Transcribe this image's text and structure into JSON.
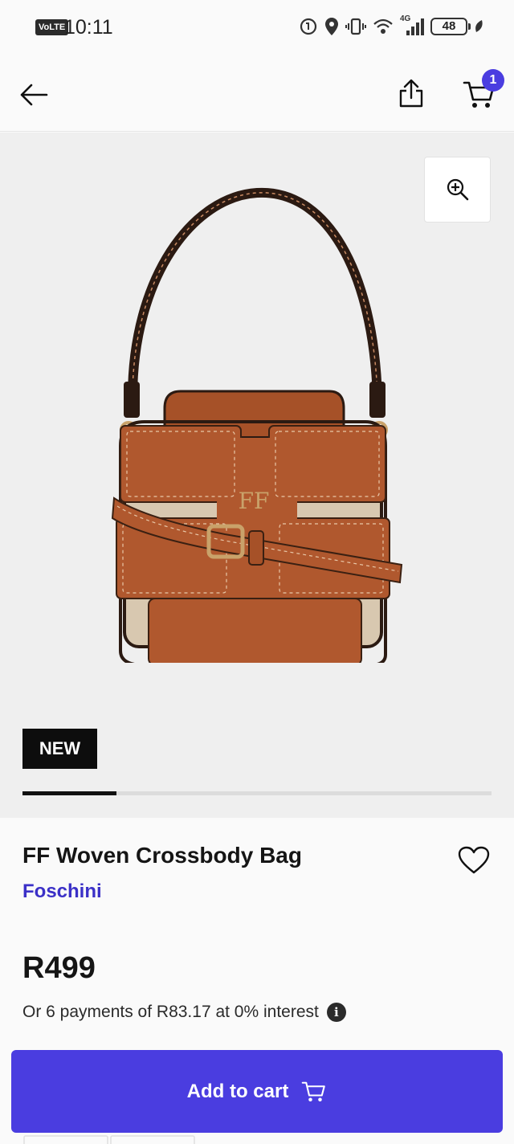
{
  "status_bar": {
    "network_badge": "VoLTE",
    "time": "10:11",
    "signal_label": "4G",
    "battery": "48"
  },
  "header": {
    "back_icon": "arrow-left-icon",
    "share_icon": "share-icon",
    "cart_icon": "cart-icon",
    "cart_count": "1"
  },
  "gallery": {
    "zoom_icon": "zoom-in-icon",
    "badge": "NEW",
    "image_index": 1,
    "image_count": 5,
    "progress_fraction": 0.2
  },
  "product": {
    "title": "FF Woven Crossbody Bag",
    "brand": "Foschini",
    "price": "R499",
    "installments": "Or 6 payments of R83.17 at 0% interest",
    "wishlist_icon": "heart-icon"
  },
  "actions": {
    "add_to_cart": "Add to cart"
  },
  "colors": {
    "accent": "#4a3de0",
    "brand_link": "#3b30c7",
    "bag_leather": "#b0582e"
  }
}
